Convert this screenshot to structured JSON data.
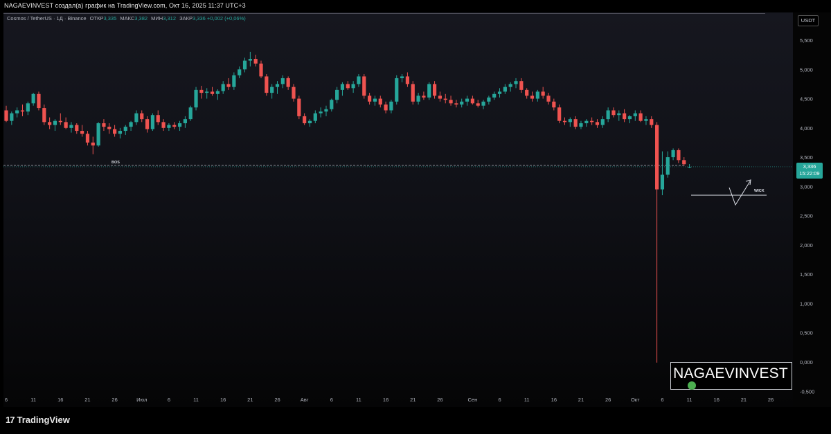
{
  "header": {
    "text": "NAGAEVINVEST создал(а) график на TradingView.com, Окт 16, 2025 11:37 UTC+3"
  },
  "legend": {
    "symbol": "Cosmos / TetherUS · 1Д · Binance",
    "open_label": "ОТКР",
    "open": "3,335",
    "high_label": "МАКС",
    "high": "3,382",
    "low_label": "МИН",
    "low": "3,312",
    "close_label": "ЗАКР",
    "close": "3,336",
    "change": "+0,002 (+0,06%)"
  },
  "price_scale": {
    "unit": "USDT",
    "last_price": "3,336",
    "countdown": "15:22:09"
  },
  "footer": {
    "brand": "TradingView",
    "brand_mark": "17"
  },
  "watermark": {
    "text": "NAGAEVINVEST"
  },
  "annotations": {
    "bos": "BOS",
    "wick": "WICK"
  },
  "colors": {
    "up": "#26a69a",
    "down": "#ef5350",
    "accent": "#26a69a"
  },
  "chart_data": {
    "type": "candlestick",
    "title": "Cosmos / TetherUS · 1Д · Binance",
    "ylim": [
      -0.55,
      5.75
    ],
    "yticks": [
      5.5,
      5.0,
      4.5,
      4.0,
      3.5,
      3.0,
      2.5,
      2.0,
      1.5,
      1.0,
      0.5,
      0.0,
      -0.5
    ],
    "ytick_labels": [
      "5,500",
      "5,000",
      "4,500",
      "4,000",
      "3,500",
      "3,000",
      "2,500",
      "2,000",
      "1,500",
      "1,000",
      "0,500",
      "0,000",
      "-0,500"
    ],
    "xticks": [
      {
        "i": 0,
        "label": "6"
      },
      {
        "i": 5,
        "label": "11"
      },
      {
        "i": 10,
        "label": "16"
      },
      {
        "i": 15,
        "label": "21"
      },
      {
        "i": 20,
        "label": "26"
      },
      {
        "i": 25,
        "label": "Июл"
      },
      {
        "i": 30,
        "label": "6"
      },
      {
        "i": 35,
        "label": "11"
      },
      {
        "i": 40,
        "label": "16"
      },
      {
        "i": 45,
        "label": "21"
      },
      {
        "i": 50,
        "label": "26"
      },
      {
        "i": 55,
        "label": "Авг"
      },
      {
        "i": 60,
        "label": "6"
      },
      {
        "i": 65,
        "label": "11"
      },
      {
        "i": 70,
        "label": "16"
      },
      {
        "i": 75,
        "label": "21"
      },
      {
        "i": 80,
        "label": "26"
      },
      {
        "i": 86,
        "label": "Сен"
      },
      {
        "i": 91,
        "label": "6"
      },
      {
        "i": 96,
        "label": "11"
      },
      {
        "i": 101,
        "label": "16"
      },
      {
        "i": 106,
        "label": "21"
      },
      {
        "i": 111,
        "label": "26"
      },
      {
        "i": 116,
        "label": "Окт"
      },
      {
        "i": 121,
        "label": "6"
      },
      {
        "i": 126,
        "label": "11"
      },
      {
        "i": 131,
        "label": "16"
      },
      {
        "i": 136,
        "label": "21"
      },
      {
        "i": 141,
        "label": "26"
      }
    ],
    "x_slots": 145,
    "bos_level": 3.36,
    "wick_level": 2.85,
    "candles": [
      [
        4.3,
        4.38,
        4.1,
        4.12
      ],
      [
        4.12,
        4.28,
        4.05,
        4.25
      ],
      [
        4.25,
        4.35,
        4.18,
        4.3
      ],
      [
        4.3,
        4.4,
        4.2,
        4.28
      ],
      [
        4.28,
        4.45,
        4.22,
        4.42
      ],
      [
        4.42,
        4.6,
        4.38,
        4.58
      ],
      [
        4.58,
        4.62,
        4.3,
        4.34
      ],
      [
        4.34,
        4.4,
        4.05,
        4.1
      ],
      [
        4.1,
        4.18,
        3.98,
        4.05
      ],
      [
        4.05,
        4.15,
        3.95,
        4.12
      ],
      [
        4.12,
        4.25,
        4.05,
        4.1
      ],
      [
        4.1,
        4.18,
        3.98,
        4.0
      ],
      [
        4.0,
        4.1,
        3.92,
        4.05
      ],
      [
        4.05,
        4.08,
        3.9,
        3.95
      ],
      [
        3.95,
        4.05,
        3.85,
        3.9
      ],
      [
        3.9,
        3.95,
        3.7,
        3.75
      ],
      [
        3.75,
        3.85,
        3.55,
        3.7
      ],
      [
        3.7,
        4.1,
        3.68,
        4.08
      ],
      [
        4.08,
        4.15,
        3.95,
        4.02
      ],
      [
        4.02,
        4.08,
        3.9,
        3.98
      ],
      [
        3.98,
        4.05,
        3.85,
        3.9
      ],
      [
        3.9,
        4.0,
        3.82,
        3.95
      ],
      [
        3.95,
        4.05,
        3.88,
        4.02
      ],
      [
        4.02,
        4.12,
        3.95,
        4.1
      ],
      [
        4.1,
        4.3,
        4.05,
        4.25
      ],
      [
        4.25,
        4.3,
        4.1,
        4.15
      ],
      [
        4.15,
        4.2,
        3.92,
        3.98
      ],
      [
        3.98,
        4.25,
        3.95,
        4.22
      ],
      [
        4.22,
        4.3,
        4.05,
        4.1
      ],
      [
        4.1,
        4.15,
        3.95,
        4.0
      ],
      [
        4.0,
        4.08,
        3.95,
        4.05
      ],
      [
        4.05,
        4.1,
        3.98,
        4.02
      ],
      [
        4.02,
        4.12,
        3.95,
        4.08
      ],
      [
        4.08,
        4.2,
        4.0,
        4.15
      ],
      [
        4.15,
        4.38,
        4.12,
        4.35
      ],
      [
        4.35,
        4.7,
        4.3,
        4.65
      ],
      [
        4.65,
        4.72,
        4.5,
        4.6
      ],
      [
        4.6,
        4.68,
        4.5,
        4.62
      ],
      [
        4.62,
        4.7,
        4.55,
        4.58
      ],
      [
        4.58,
        4.66,
        4.48,
        4.63
      ],
      [
        4.63,
        4.8,
        4.58,
        4.75
      ],
      [
        4.75,
        4.85,
        4.65,
        4.7
      ],
      [
        4.7,
        4.95,
        4.65,
        4.9
      ],
      [
        4.9,
        5.05,
        4.85,
        5.0
      ],
      [
        5.0,
        5.2,
        4.95,
        5.15
      ],
      [
        5.15,
        5.3,
        5.05,
        5.18
      ],
      [
        5.18,
        5.25,
        5.05,
        5.1
      ],
      [
        5.1,
        5.15,
        4.85,
        4.88
      ],
      [
        4.88,
        4.92,
        4.55,
        4.6
      ],
      [
        4.6,
        4.75,
        4.5,
        4.7
      ],
      [
        4.7,
        4.8,
        4.58,
        4.75
      ],
      [
        4.75,
        4.9,
        4.68,
        4.85
      ],
      [
        4.85,
        4.88,
        4.65,
        4.7
      ],
      [
        4.7,
        4.75,
        4.45,
        4.5
      ],
      [
        4.5,
        4.55,
        4.15,
        4.2
      ],
      [
        4.2,
        4.25,
        4.05,
        4.08
      ],
      [
        4.08,
        4.15,
        4.02,
        4.12
      ],
      [
        4.12,
        4.3,
        4.08,
        4.25
      ],
      [
        4.25,
        4.35,
        4.18,
        4.28
      ],
      [
        4.28,
        4.38,
        4.2,
        4.32
      ],
      [
        4.32,
        4.5,
        4.28,
        4.48
      ],
      [
        4.48,
        4.7,
        4.42,
        4.65
      ],
      [
        4.65,
        4.78,
        4.55,
        4.75
      ],
      [
        4.75,
        4.8,
        4.65,
        4.68
      ],
      [
        4.68,
        4.8,
        4.6,
        4.75
      ],
      [
        4.75,
        4.92,
        4.7,
        4.88
      ],
      [
        4.88,
        4.92,
        4.5,
        4.55
      ],
      [
        4.55,
        4.6,
        4.4,
        4.45
      ],
      [
        4.45,
        4.55,
        4.38,
        4.5
      ],
      [
        4.5,
        4.55,
        4.35,
        4.4
      ],
      [
        4.4,
        4.45,
        4.25,
        4.3
      ],
      [
        4.3,
        4.48,
        4.25,
        4.45
      ],
      [
        4.45,
        4.9,
        4.4,
        4.85
      ],
      [
        4.85,
        4.92,
        4.78,
        4.88
      ],
      [
        4.88,
        4.95,
        4.7,
        4.75
      ],
      [
        4.75,
        4.8,
        4.4,
        4.45
      ],
      [
        4.45,
        4.6,
        4.4,
        4.55
      ],
      [
        4.55,
        4.62,
        4.48,
        4.52
      ],
      [
        4.52,
        4.78,
        4.48,
        4.75
      ],
      [
        4.75,
        4.8,
        4.5,
        4.55
      ],
      [
        4.55,
        4.62,
        4.45,
        4.5
      ],
      [
        4.5,
        4.58,
        4.42,
        4.48
      ],
      [
        4.48,
        4.55,
        4.38,
        4.42
      ],
      [
        4.42,
        4.48,
        4.35,
        4.4
      ],
      [
        4.4,
        4.5,
        4.35,
        4.45
      ],
      [
        4.45,
        4.55,
        4.38,
        4.5
      ],
      [
        4.5,
        4.55,
        4.4,
        4.42
      ],
      [
        4.42,
        4.48,
        4.35,
        4.38
      ],
      [
        4.38,
        4.48,
        4.32,
        4.45
      ],
      [
        4.45,
        4.55,
        4.4,
        4.52
      ],
      [
        4.52,
        4.62,
        4.48,
        4.58
      ],
      [
        4.58,
        4.68,
        4.52,
        4.62
      ],
      [
        4.62,
        4.75,
        4.58,
        4.7
      ],
      [
        4.7,
        4.78,
        4.62,
        4.75
      ],
      [
        4.75,
        4.85,
        4.68,
        4.8
      ],
      [
        4.8,
        4.85,
        4.6,
        4.65
      ],
      [
        4.65,
        4.68,
        4.5,
        4.55
      ],
      [
        4.55,
        4.62,
        4.45,
        4.5
      ],
      [
        4.5,
        4.65,
        4.45,
        4.62
      ],
      [
        4.62,
        4.7,
        4.5,
        4.55
      ],
      [
        4.55,
        4.6,
        4.4,
        4.45
      ],
      [
        4.45,
        4.5,
        4.3,
        4.35
      ],
      [
        4.35,
        4.4,
        4.08,
        4.12
      ],
      [
        4.12,
        4.18,
        4.05,
        4.1
      ],
      [
        4.1,
        4.18,
        4.02,
        4.15
      ],
      [
        4.15,
        4.2,
        3.98,
        4.02
      ],
      [
        4.02,
        4.12,
        3.98,
        4.08
      ],
      [
        4.08,
        4.15,
        4.02,
        4.12
      ],
      [
        4.12,
        4.18,
        4.05,
        4.1
      ],
      [
        4.1,
        4.15,
        4.0,
        4.05
      ],
      [
        4.05,
        4.2,
        4.0,
        4.15
      ],
      [
        4.15,
        4.35,
        4.1,
        4.3
      ],
      [
        4.3,
        4.35,
        4.18,
        4.22
      ],
      [
        4.22,
        4.3,
        4.12,
        4.25
      ],
      [
        4.25,
        4.32,
        4.1,
        4.15
      ],
      [
        4.15,
        4.22,
        4.08,
        4.2
      ],
      [
        4.2,
        4.3,
        4.12,
        4.25
      ],
      [
        4.25,
        4.3,
        4.1,
        4.12
      ],
      [
        4.12,
        4.2,
        4.05,
        4.15
      ],
      [
        4.15,
        4.2,
        4.0,
        4.05
      ],
      [
        4.05,
        4.1,
        -0.01,
        2.95
      ],
      [
        2.95,
        3.6,
        2.85,
        3.2
      ],
      [
        3.2,
        3.6,
        3.15,
        3.5
      ],
      [
        3.5,
        3.65,
        3.45,
        3.62
      ],
      [
        3.62,
        3.65,
        3.4,
        3.45
      ],
      [
        3.45,
        3.5,
        3.35,
        3.38
      ],
      [
        3.335,
        3.382,
        3.312,
        3.336
      ]
    ],
    "first_candle_slot": 0
  }
}
